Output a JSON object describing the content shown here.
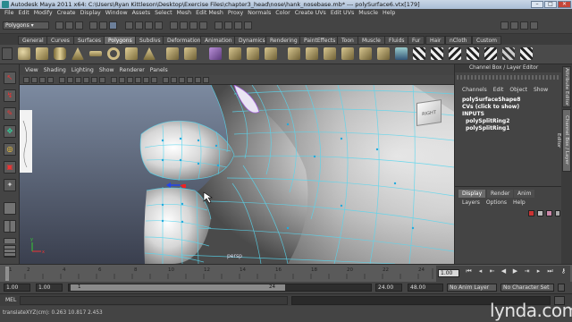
{
  "titlebar": {
    "title": "Autodesk Maya 2011 x64: C:\\Users\\Ryan Kittleson\\Desktop\\Exercise Files\\chapter3_head\\nose\\hank_nosebase.mb*  ---  polySurface6.vtx[179]",
    "min": "–",
    "max": "□",
    "close": "✕"
  },
  "menubar": [
    "File",
    "Edit",
    "Modify",
    "Create",
    "Display",
    "Window",
    "Assets",
    "Select",
    "Mesh",
    "Edit Mesh",
    "Proxy",
    "Normals",
    "Color",
    "Create UVs",
    "Edit UVs",
    "Muscle",
    "Help"
  ],
  "statusline": {
    "menuset": "Polygons"
  },
  "shelf_tabs": [
    "General",
    "Curves",
    "Surfaces",
    "Polygons",
    "Subdivs",
    "Deformation",
    "Animation",
    "Dynamics",
    "Rendering",
    "PaintEffects",
    "Toon",
    "Muscle",
    "Fluids",
    "Fur",
    "Hair",
    "nCloth",
    "Custom"
  ],
  "shelf_active": "Polygons",
  "panel_menu": [
    "View",
    "Shading",
    "Lighting",
    "Show",
    "Renderer",
    "Panels"
  ],
  "viewport": {
    "camera_label": "persp",
    "viewcube_label": "RIGHT"
  },
  "channel_box": {
    "title": "Channel Box / Layer Editor",
    "menu": [
      "Channels",
      "Edit",
      "Object",
      "Show"
    ],
    "object_name": "polySurfaceShape8",
    "cvs_text": "CVs (click to show)",
    "inputs_label": "INPUTS",
    "inputs": [
      "polySplitRing2",
      "polySplitRing1"
    ]
  },
  "layer_editor": {
    "tabs": [
      "Display",
      "Render",
      "Anim"
    ],
    "active_tab": "Display",
    "menu": [
      "Layers",
      "Options",
      "Help"
    ]
  },
  "side_tabs": [
    "Attribute Editor",
    "Channel Box / Layer Editor"
  ],
  "timeline": {
    "ticks": [
      "1",
      "2",
      "4",
      "6",
      "8",
      "10",
      "12",
      "14",
      "16",
      "18",
      "20",
      "22",
      "24"
    ],
    "current_frame": "1.00"
  },
  "range": {
    "start": "1.00",
    "inner_start": "1.00",
    "slider_start": "1",
    "slider_end": "24",
    "inner_end": "24.00",
    "end": "48.00",
    "anim_layer": "No Anim Layer",
    "char_set": "No Character Set"
  },
  "command": {
    "label": "MEL"
  },
  "helpline": {
    "text": "translateXYZ(cm):   0.263   10.817   2.453"
  },
  "watermark": "lynda.com",
  "colors": {
    "accent": "#4a7fc1",
    "mesh_wire": "#58d6ee",
    "viewport_bg_top": "#7c8aa0"
  }
}
